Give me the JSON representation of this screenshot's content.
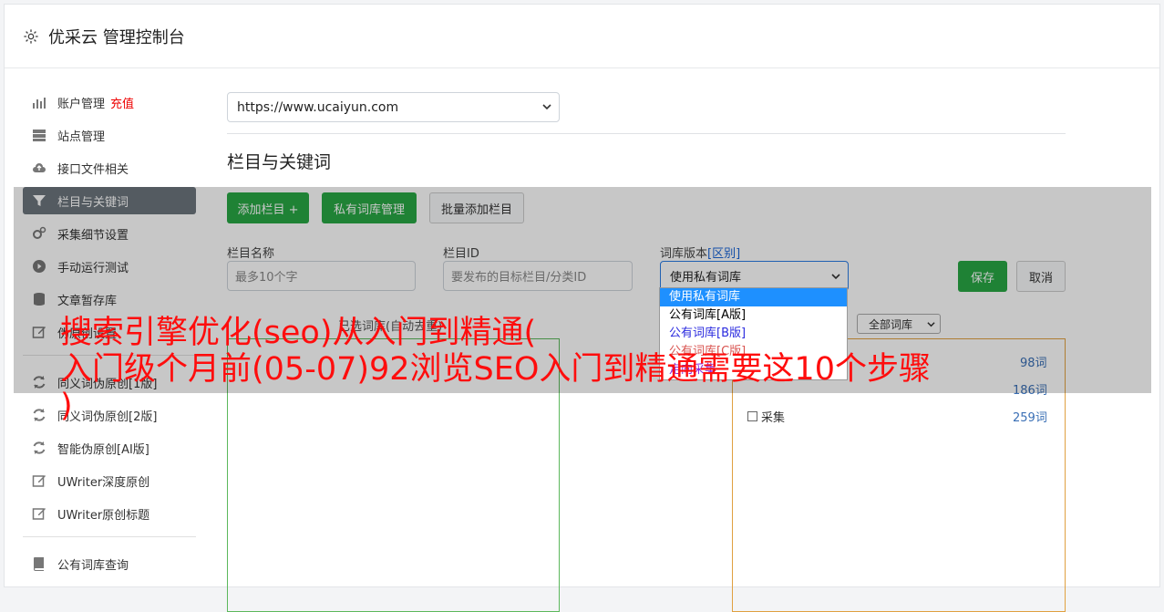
{
  "header": {
    "title": "优采云 管理控制台",
    "icon": "gear-icon"
  },
  "sidebar": {
    "recharge": "充值",
    "items": [
      {
        "label": "账户管理",
        "icon": "bar-chart-icon"
      },
      {
        "label": "站点管理",
        "icon": "server-icon"
      },
      {
        "label": "接口文件相关",
        "icon": "cloud-upload-icon"
      },
      {
        "label": "栏目与关键词",
        "icon": "filter-icon"
      },
      {
        "label": "采集细节设置",
        "icon": "cogs-icon"
      },
      {
        "label": "手动运行测试",
        "icon": "play-circle-icon"
      },
      {
        "label": "文章暂存库",
        "icon": "database-icon"
      },
      {
        "label": "伪原创设置",
        "icon": "edit-icon"
      },
      {
        "label": "同义词伪原创[1版]",
        "icon": "refresh-icon"
      },
      {
        "label": "同义词伪原创[2版]",
        "icon": "refresh-icon"
      },
      {
        "label": "智能伪原创[AI版]",
        "icon": "refresh-icon"
      },
      {
        "label": "UWriter深度原创",
        "icon": "edit-icon"
      },
      {
        "label": "UWriter原创标题",
        "icon": "edit-icon"
      },
      {
        "label": "公有词库查询",
        "icon": "book-icon"
      }
    ]
  },
  "main": {
    "site_select": "https://www.ucaiyun.com",
    "section_title": "栏目与关键词",
    "buttons": {
      "add_column": "添加栏目 +",
      "private_lexicon": "私有词库管理",
      "batch_add": "批量添加栏目"
    },
    "fields": {
      "name_label": "栏目名称",
      "name_placeholder": "最多10个字",
      "id_label": "栏目ID",
      "id_placeholder": "要发布的目标栏目/分类ID",
      "version_label": "词库版本",
      "version_link": "[区别]",
      "version_value": "使用私有词库"
    },
    "dropdown_options": [
      "使用私有词库",
      "公有词库[A版]",
      "公有词库[B版]",
      "公有词库[C版]",
      "定向采集"
    ],
    "save": "保存",
    "cancel": "取消",
    "selected_lexicon_label": "已选词库(自动去重)",
    "all_lexicon": "全部词库",
    "counts": [
      "98词",
      "186词",
      "259词"
    ],
    "checkbox_label": "采集"
  },
  "overlay": {
    "line1": "搜索引擎优化(seo)从入门到精通(",
    "line2": "入门级个月前(05-07)92浏览SEO入门到精通需要这10个步骤",
    "line3": ")"
  },
  "colors": {
    "primary_green": "#28a745",
    "overlay_red": "#ff0d0d",
    "active_nav": "#6c757d"
  }
}
